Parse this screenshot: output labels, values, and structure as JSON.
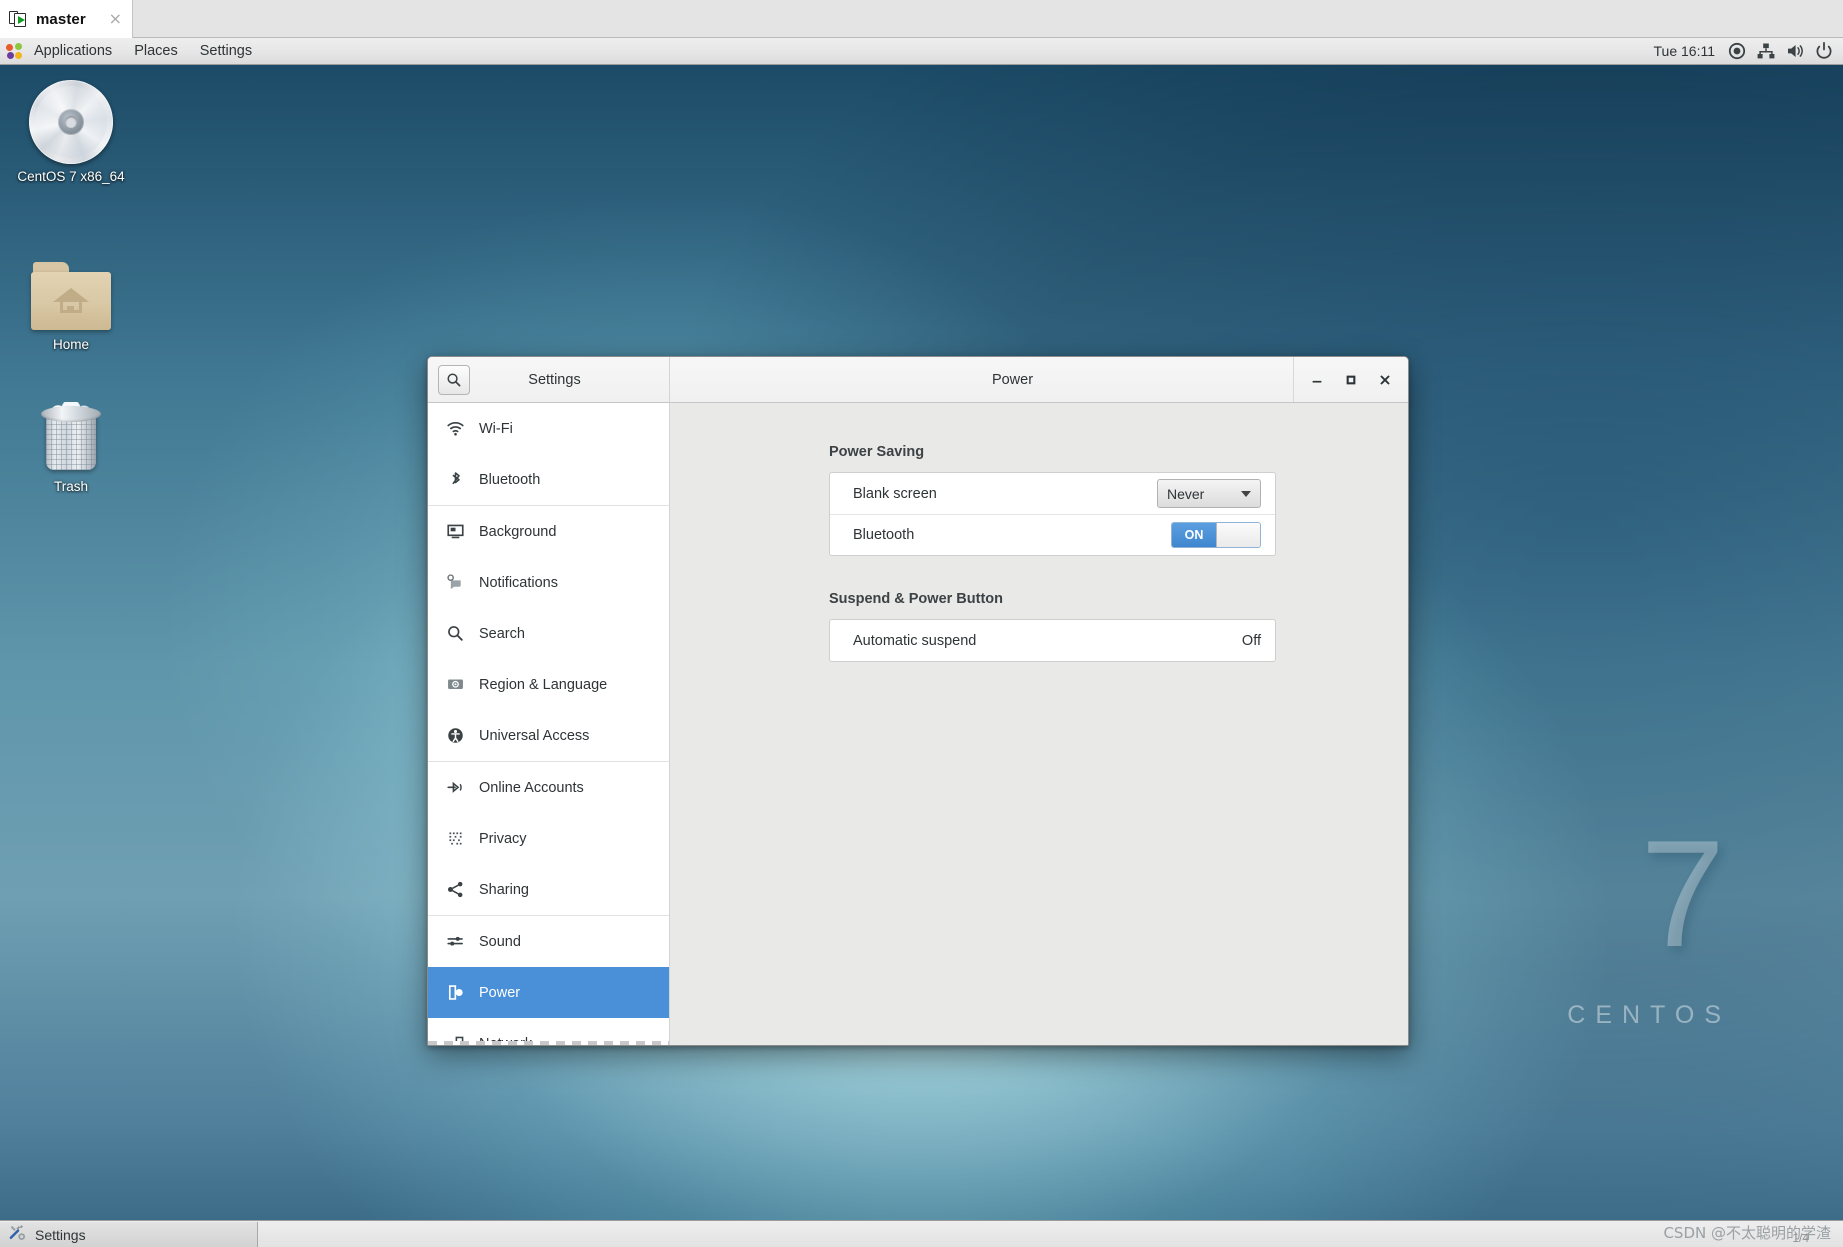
{
  "vm_tab": {
    "label": "master",
    "close_label": "×",
    "icon": "vm-window-play-icon"
  },
  "top_panel": {
    "menus": [
      {
        "label": "Applications",
        "icon": "applications-icon"
      },
      {
        "label": "Places",
        "icon": null
      },
      {
        "label": "Settings",
        "icon": null
      }
    ],
    "clock": "Tue 16:11",
    "tray": [
      {
        "icon": "accessibility-record-icon"
      },
      {
        "icon": "network-wired-icon"
      },
      {
        "icon": "volume-icon"
      },
      {
        "icon": "power-icon"
      }
    ]
  },
  "desktop": {
    "icons": [
      {
        "label": "CentOS 7 x86_64",
        "icon": "cd-disc-icon"
      },
      {
        "label": "Home",
        "icon": "home-folder-icon"
      },
      {
        "label": "Trash",
        "icon": "trash-can-icon"
      }
    ],
    "wallpaper_watermark": {
      "number": "7",
      "word": "CENTOS"
    },
    "accent_blue": "#4a90d9",
    "wallpaper_teal": "#6fb0bb",
    "wallpaper_deep_blue": "#1c4b67"
  },
  "window": {
    "sidebar_header_title": "Settings",
    "page_title": "Power",
    "search_icon": "search-icon",
    "controls": [
      {
        "name": "minimize",
        "glyph": "—"
      },
      {
        "name": "maximize",
        "glyph": "□"
      },
      {
        "name": "close",
        "glyph": "✕"
      }
    ]
  },
  "sidebar": {
    "groups": [
      {
        "items": [
          {
            "label": "Wi-Fi",
            "icon": "wifi-icon",
            "selected": false
          },
          {
            "label": "Bluetooth",
            "icon": "bluetooth-icon",
            "selected": false
          }
        ]
      },
      {
        "items": [
          {
            "label": "Background",
            "icon": "background-monitor-icon",
            "selected": false
          },
          {
            "label": "Notifications",
            "icon": "notifications-icon",
            "selected": false
          },
          {
            "label": "Search",
            "icon": "search-icon",
            "selected": false
          },
          {
            "label": "Region & Language",
            "icon": "region-language-icon",
            "selected": false
          },
          {
            "label": "Universal Access",
            "icon": "universal-access-icon",
            "selected": false
          }
        ]
      },
      {
        "items": [
          {
            "label": "Online Accounts",
            "icon": "online-accounts-icon",
            "selected": false
          },
          {
            "label": "Privacy",
            "icon": "privacy-icon",
            "selected": false
          },
          {
            "label": "Sharing",
            "icon": "sharing-icon",
            "selected": false
          }
        ]
      },
      {
        "items": [
          {
            "label": "Sound",
            "icon": "sound-sliders-icon",
            "selected": false
          },
          {
            "label": "Power",
            "icon": "power-plug-icon",
            "selected": true
          },
          {
            "label": "Network",
            "icon": "network-icon",
            "selected": false
          }
        ]
      }
    ]
  },
  "content": {
    "sections": [
      {
        "title": "Power Saving",
        "rows": [
          {
            "label": "Blank screen",
            "control": "combo",
            "value": "Never"
          },
          {
            "label": "Bluetooth",
            "control": "toggle",
            "value": "ON",
            "state": "on"
          }
        ]
      },
      {
        "title": "Suspend & Power Button",
        "rows": [
          {
            "label": "Automatic suspend",
            "control": "value",
            "value": "Off"
          }
        ]
      }
    ]
  },
  "taskbar": {
    "window_button": {
      "label": "Settings",
      "icon": "tools-settings-icon"
    }
  },
  "watermark": {
    "text": "CSDN @不太聪明的学渣",
    "page": "1/4"
  }
}
